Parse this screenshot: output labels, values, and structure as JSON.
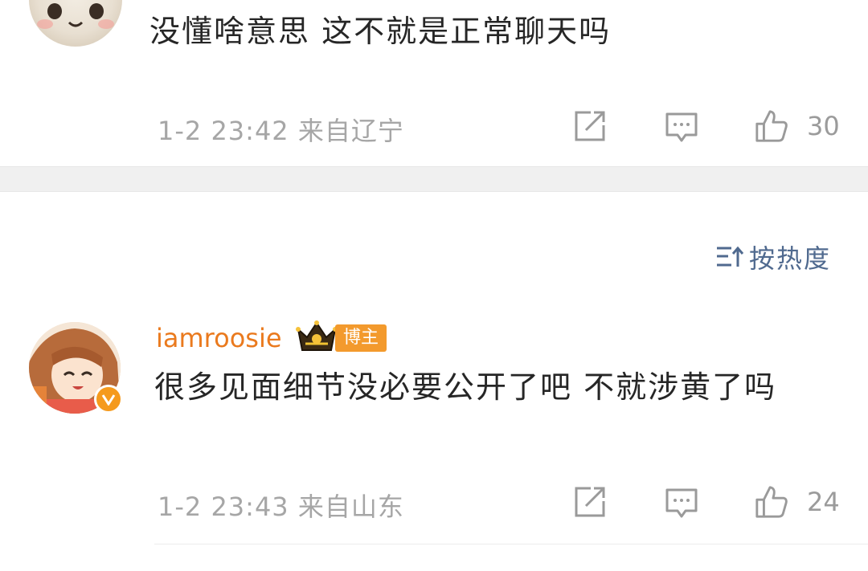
{
  "comments": [
    {
      "text": "没懂啥意思 这不就是正常聊天吗",
      "time": "1-2 23:42",
      "location": "来自辽宁",
      "likes": "30",
      "icons": [
        "share-icon",
        "comment-icon",
        "like-icon"
      ]
    },
    {
      "username": "iamroosie",
      "badge": "博主",
      "text": "很多见面细节没必要公开了吧 不就涉黄了吗",
      "time": "1-2 23:43",
      "location": "来自山东",
      "likes": "24",
      "icons": [
        "share-icon",
        "comment-icon",
        "like-icon"
      ]
    }
  ],
  "sort_label": "按热度",
  "colors": {
    "username": "#ea7a1e",
    "sort": "#506a8f",
    "badge": "#f39a2d"
  }
}
